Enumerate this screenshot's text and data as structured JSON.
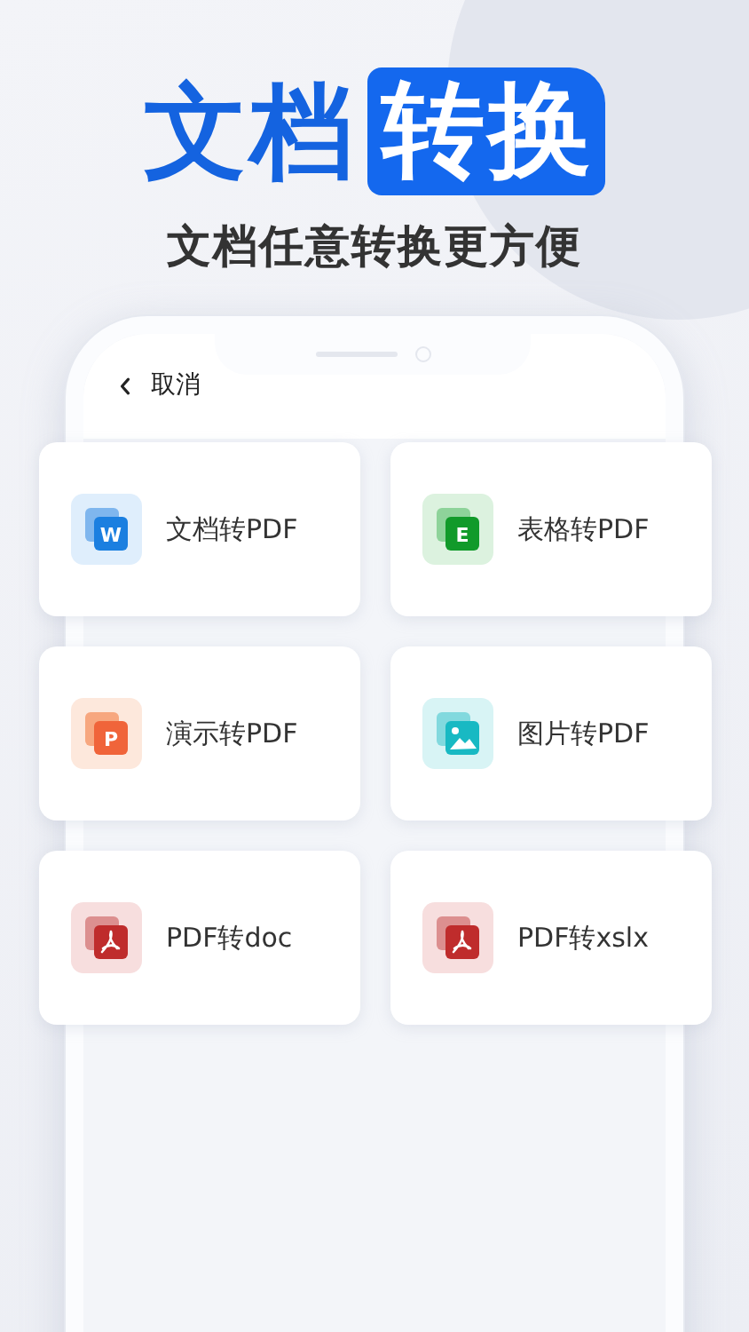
{
  "headline": {
    "plain": "文档",
    "boxed": "转换"
  },
  "subtitle": "文档任意转换更方便",
  "nav": {
    "back_label": "取消"
  },
  "tools": [
    {
      "label": "文档转PDF",
      "kind": "word",
      "badge": "W"
    },
    {
      "label": "表格转PDF",
      "kind": "excel",
      "badge": "E"
    },
    {
      "label": "演示转PDF",
      "kind": "ppt",
      "badge": "P"
    },
    {
      "label": "图片转PDF",
      "kind": "image"
    },
    {
      "label": "PDF转doc",
      "kind": "pdf"
    },
    {
      "label": "PDF转xslx",
      "kind": "pdf"
    }
  ]
}
